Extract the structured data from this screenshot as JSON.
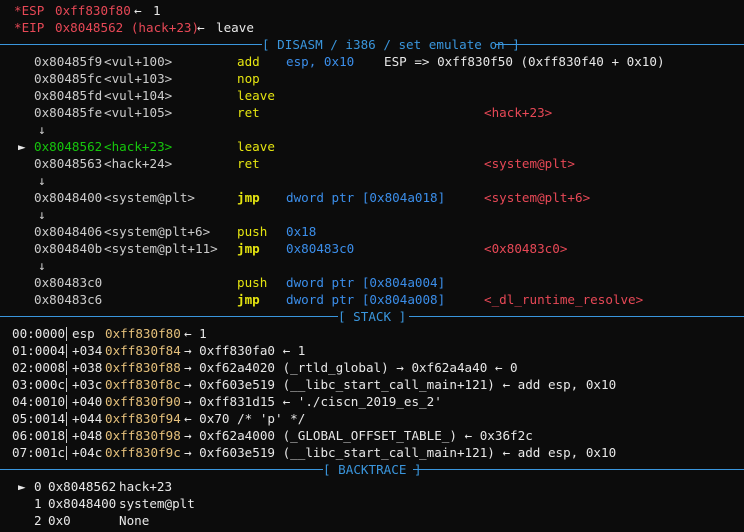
{
  "registers": [
    {
      "name": "*ESP",
      "value": "0xff830f80",
      "arrow": "←",
      "rest": "1"
    },
    {
      "name": "*EIP",
      "value": "0x8048562 (hack+23)",
      "arrow": "←",
      "rest": "leave"
    }
  ],
  "sections": {
    "disasm": "[ DISASM / i386 / set emulate on ]",
    "stack": "[ STACK ]",
    "backtrace": "[ BACKTRACE ]"
  },
  "disasm": [
    {
      "marker": "",
      "addr": "0x80485f9",
      "sym": "<vul+100>",
      "mn": "add",
      "ops": "esp, 0x10",
      "extra": "ESP => 0xff830f50 (0xff830f40 + 0x10)",
      "cmt": ""
    },
    {
      "marker": "",
      "addr": "0x80485fc",
      "sym": "<vul+103>",
      "mn": "nop",
      "ops": "",
      "extra": "",
      "cmt": ""
    },
    {
      "marker": "",
      "addr": "0x80485fd",
      "sym": "<vul+104>",
      "mn": "leave",
      "ops": "",
      "extra": "",
      "cmt": ""
    },
    {
      "marker": "",
      "addr": "0x80485fe",
      "sym": "<vul+105>",
      "mn": "ret",
      "ops": "",
      "extra": "",
      "cmt": "<hack+23>"
    },
    {
      "marker": "↓"
    },
    {
      "marker": "►",
      "addr": "0x8048562",
      "sym": "<hack+23>",
      "mn": "leave",
      "ops": "",
      "extra": "",
      "cmt": "",
      "current": true
    },
    {
      "marker": "",
      "addr": "0x8048563",
      "sym": "<hack+24>",
      "mn": "ret",
      "ops": "",
      "extra": "",
      "cmt": "<system@plt>"
    },
    {
      "marker": "↓"
    },
    {
      "marker": "",
      "addr": "0x8048400",
      "sym": "<system@plt>",
      "mn": "jmp",
      "ops": "dword ptr [0x804a018]",
      "extra": "",
      "cmt": "<system@plt+6>"
    },
    {
      "marker": "↓"
    },
    {
      "marker": "",
      "addr": "0x8048406",
      "sym": "<system@plt+6>",
      "mn": "push",
      "ops": "0x18",
      "extra": "",
      "cmt": ""
    },
    {
      "marker": "",
      "addr": "0x804840b",
      "sym": "<system@plt+11>",
      "mn": "jmp",
      "ops": "0x80483c0",
      "extra": "",
      "cmt": "<0x80483c0>"
    },
    {
      "marker": "↓"
    },
    {
      "marker": "",
      "addr": "0x80483c0",
      "sym": "",
      "mn": "push",
      "ops": "dword ptr [0x804a004]",
      "extra": "",
      "cmt": ""
    },
    {
      "marker": "",
      "addr": "0x80483c6",
      "sym": "",
      "mn": "jmp",
      "ops": "dword ptr [0x804a008]",
      "extra": "",
      "cmt": "<_dl_runtime_resolve>"
    }
  ],
  "stack": [
    {
      "idx": "00:0000",
      "reg": "esp",
      "addr": "0xff830f80",
      "chain": "← 1"
    },
    {
      "idx": "01:0004",
      "reg": "+034",
      "addr": "0xff830f84",
      "chain": "→ 0xff830fa0 ← 1"
    },
    {
      "idx": "02:0008",
      "reg": "+038",
      "addr": "0xff830f88",
      "chain": "→ 0xf62a4020 (_rtld_global) → 0xf62a4a40 ← 0"
    },
    {
      "idx": "03:000c",
      "reg": "+03c",
      "addr": "0xff830f8c",
      "chain": "→ 0xf603e519 (__libc_start_call_main+121) ← add esp, 0x10"
    },
    {
      "idx": "04:0010",
      "reg": "+040",
      "addr": "0xff830f90",
      "chain": "→ 0xff831d15 ← './ciscn_2019_es_2'"
    },
    {
      "idx": "05:0014",
      "reg": "+044",
      "addr": "0xff830f94",
      "chain": "← 0x70 /* 'p' */"
    },
    {
      "idx": "06:0018",
      "reg": "+048",
      "addr": "0xff830f98",
      "chain": "→ 0xf62a4000 (_GLOBAL_OFFSET_TABLE_) ← 0x36f2c"
    },
    {
      "idx": "07:001c",
      "reg": "+04c",
      "addr": "0xff830f9c",
      "chain": "→ 0xf603e519 (__libc_start_call_main+121) ← add esp, 0x10"
    }
  ],
  "backtrace": [
    {
      "marker": "►",
      "n": "0",
      "addr": "0x8048562",
      "fn": "hack+23"
    },
    {
      "marker": "",
      "n": "1",
      "addr": "0x8048400",
      "fn": "system@plt"
    },
    {
      "marker": "",
      "n": "2",
      "addr": "0x0",
      "fn": "None"
    }
  ]
}
